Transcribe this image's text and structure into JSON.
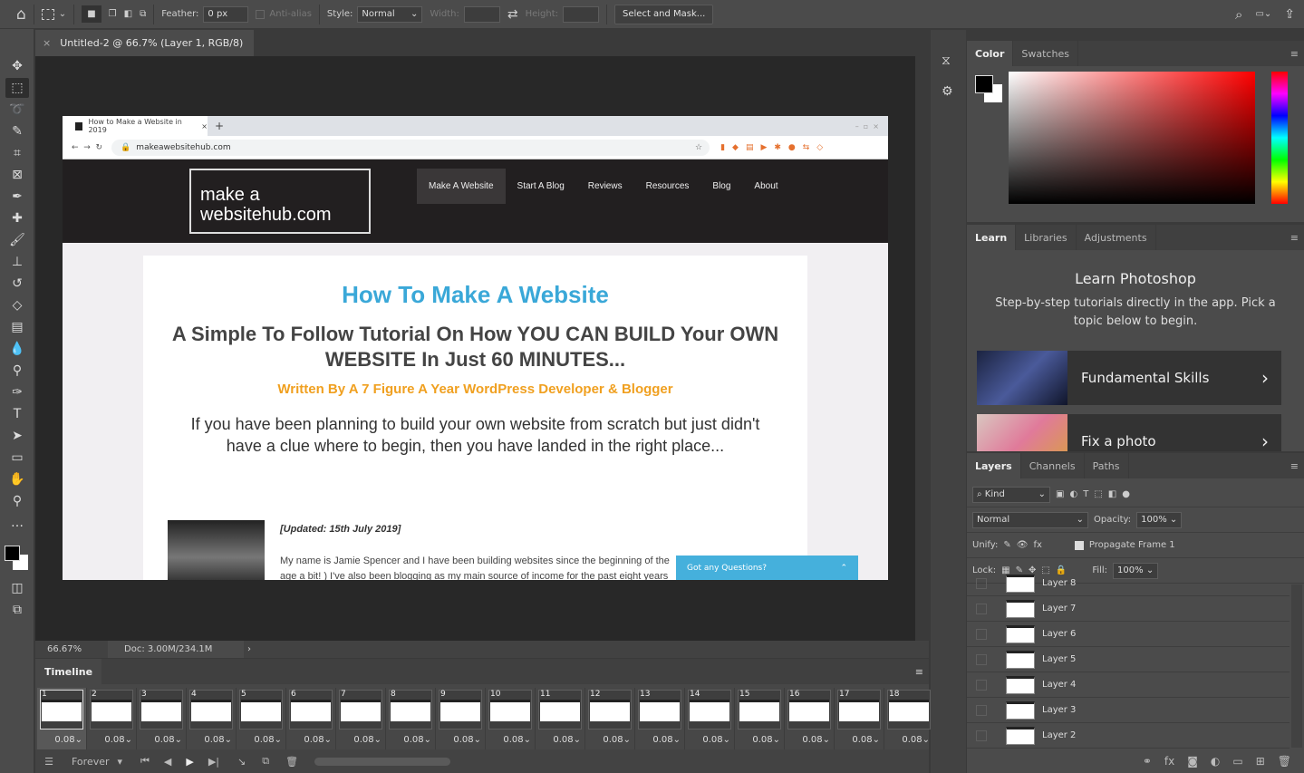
{
  "options_bar": {
    "feather_label": "Feather:",
    "feather_value": "0 px",
    "anti_alias": "Anti-alias",
    "style_label": "Style:",
    "style_value": "Normal",
    "width_label": "Width:",
    "height_label": "Height:",
    "select_mask": "Select and Mask..."
  },
  "document": {
    "tab_title": "Untitled-2 @ 66.7% (Layer 1, RGB/8)",
    "zoom": "66.67%",
    "doc_size": "Doc: 3.00M/234.1M"
  },
  "tools": [
    "move-icon",
    "marquee-icon",
    "lasso-icon",
    "quick-select-icon",
    "crop-icon",
    "frame-icon",
    "eyedropper-icon",
    "healing-icon",
    "brush-icon",
    "stamp-icon",
    "history-brush-icon",
    "eraser-icon",
    "gradient-icon",
    "blur-icon",
    "dodge-icon",
    "pen-icon",
    "type-icon",
    "path-select-icon",
    "rectangle-icon",
    "hand-icon",
    "zoom-icon",
    "more-icon"
  ],
  "webpage": {
    "browser_tab": "How to Make a Website in 2019",
    "url": "makeawebsitehub.com",
    "logo": "make a websitehub.com",
    "nav": [
      "Make A Website",
      "Start A Blog",
      "Reviews",
      "Resources",
      "Blog",
      "About"
    ],
    "title": "How To Make A Website",
    "subtitle": "A Simple To Follow Tutorial On How YOU CAN BUILD Your OWN WEBSITE In Just 60 MINUTES...",
    "byline": "Written By A 7 Figure A Year WordPress Developer & Blogger",
    "intro": "If you have been planning to build your own website from scratch but just didn't have a clue where to begin, then you have landed in the right place...",
    "updated": "[Updated: 15th July 2019]",
    "body1": "My name is Jamie Spencer and I have been building websites since the beginning of the",
    "body2": "age a bit! ) I've also been blogging as my main source of income for the past eight years",
    "chat": "Got any Questions?",
    "colors": {
      "title": "#3aa8d8",
      "byline": "#f0a020",
      "chat": "#45b0dc"
    }
  },
  "timeline": {
    "title": "Timeline",
    "loop": "Forever",
    "frames": [
      {
        "n": "1",
        "d": "0.08"
      },
      {
        "n": "2",
        "d": "0.08"
      },
      {
        "n": "3",
        "d": "0.08"
      },
      {
        "n": "4",
        "d": "0.08"
      },
      {
        "n": "5",
        "d": "0.08"
      },
      {
        "n": "6",
        "d": "0.08"
      },
      {
        "n": "7",
        "d": "0.08"
      },
      {
        "n": "8",
        "d": "0.08"
      },
      {
        "n": "9",
        "d": "0.08"
      },
      {
        "n": "10",
        "d": "0.08"
      },
      {
        "n": "11",
        "d": "0.08"
      },
      {
        "n": "12",
        "d": "0.08"
      },
      {
        "n": "13",
        "d": "0.08"
      },
      {
        "n": "14",
        "d": "0.08"
      },
      {
        "n": "15",
        "d": "0.08"
      },
      {
        "n": "16",
        "d": "0.08"
      },
      {
        "n": "17",
        "d": "0.08"
      },
      {
        "n": "18",
        "d": "0.08"
      }
    ]
  },
  "color_panel": {
    "tabs": [
      "Color",
      "Swatches"
    ]
  },
  "learn_panel": {
    "tabs": [
      "Learn",
      "Libraries",
      "Adjustments"
    ],
    "heading": "Learn Photoshop",
    "desc": "Step-by-step tutorials directly in the app. Pick a topic below to begin.",
    "cards": [
      "Fundamental Skills",
      "Fix a photo"
    ]
  },
  "layers_panel": {
    "tabs": [
      "Layers",
      "Channels",
      "Paths"
    ],
    "kind": "Kind",
    "blend": "Normal",
    "opacity_label": "Opacity:",
    "opacity": "100%",
    "unify_label": "Unify:",
    "propagate": "Propagate Frame 1",
    "lock_label": "Lock:",
    "fill_label": "Fill:",
    "fill": "100%",
    "layers": [
      "Layer 8",
      "Layer 7",
      "Layer 6",
      "Layer 5",
      "Layer 4",
      "Layer 3",
      "Layer 2"
    ]
  }
}
